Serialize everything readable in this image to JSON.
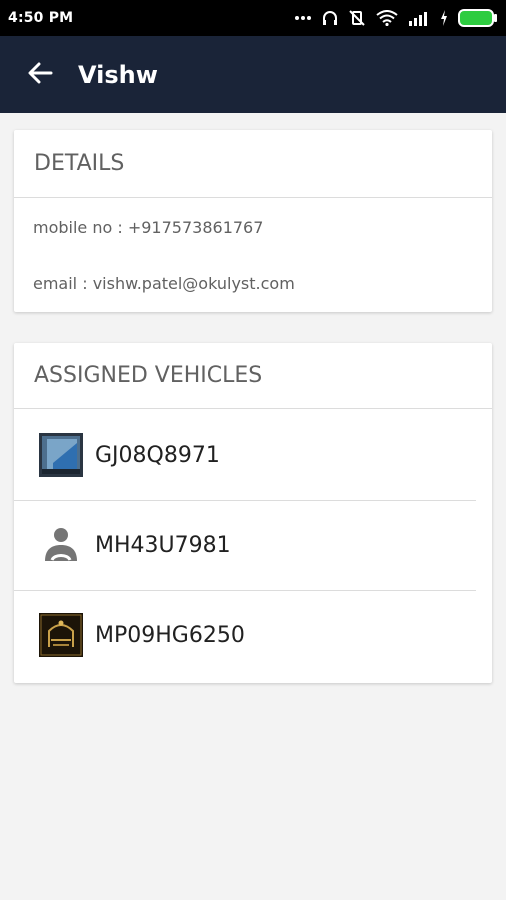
{
  "status_bar": {
    "time": "4:50 PM",
    "icons": [
      "more-dots-icon",
      "headphones-icon",
      "vibrate-off-icon",
      "wifi-icon",
      "signal-icon",
      "charging-bolt-icon",
      "battery-icon"
    ],
    "battery_level": 1.0,
    "battery_color": "#2ecc40"
  },
  "app_bar": {
    "title": "Vishw",
    "background": "#1a2438",
    "back_icon": "arrow-left-icon"
  },
  "details_card": {
    "header": "DETAILS",
    "mobile": "mobile no : +917573861767",
    "email": "email : vishw.patel@okulyst.com"
  },
  "vehicles_card": {
    "header": "ASSIGNED VEHICLES",
    "items": [
      {
        "label": "GJ08Q8971",
        "icon": "vehicle-photo-thumbnail"
      },
      {
        "label": "MH43U7981",
        "icon": "person-placeholder-icon"
      },
      {
        "label": "MP09HG6250",
        "icon": "eid-mubarak-thumbnail"
      }
    ]
  }
}
